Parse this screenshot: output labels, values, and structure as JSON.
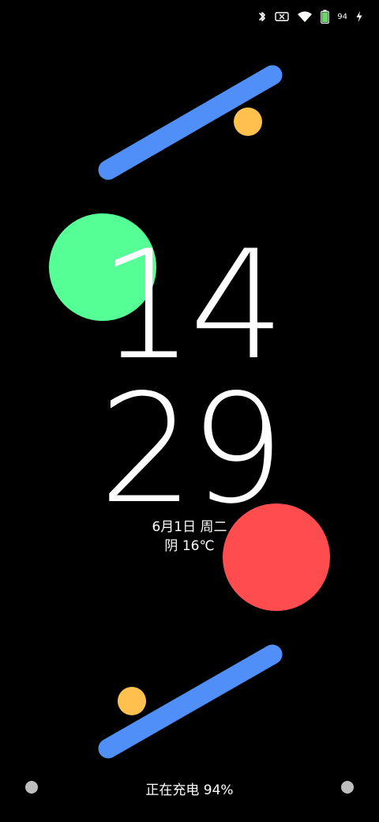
{
  "status_bar": {
    "icons": [
      "bluetooth-icon",
      "no-sim-icon",
      "wifi-icon",
      "battery-icon",
      "charging-bolt-icon"
    ],
    "battery_level": "94"
  },
  "lockscreen": {
    "hour": "14",
    "minute": "29",
    "date": "6月1日 周二",
    "weather": "阴 16℃",
    "charging_status": "正在充电 94%",
    "corner_shortcuts": [
      "left-shortcut-dot",
      "right-shortcut-dot"
    ]
  },
  "decor_colors": {
    "blue": "#4f8ff7",
    "yellow": "#ffc14d",
    "green": "#55ff96",
    "red": "#ff4d4f",
    "dot": "#bdbdbd"
  }
}
